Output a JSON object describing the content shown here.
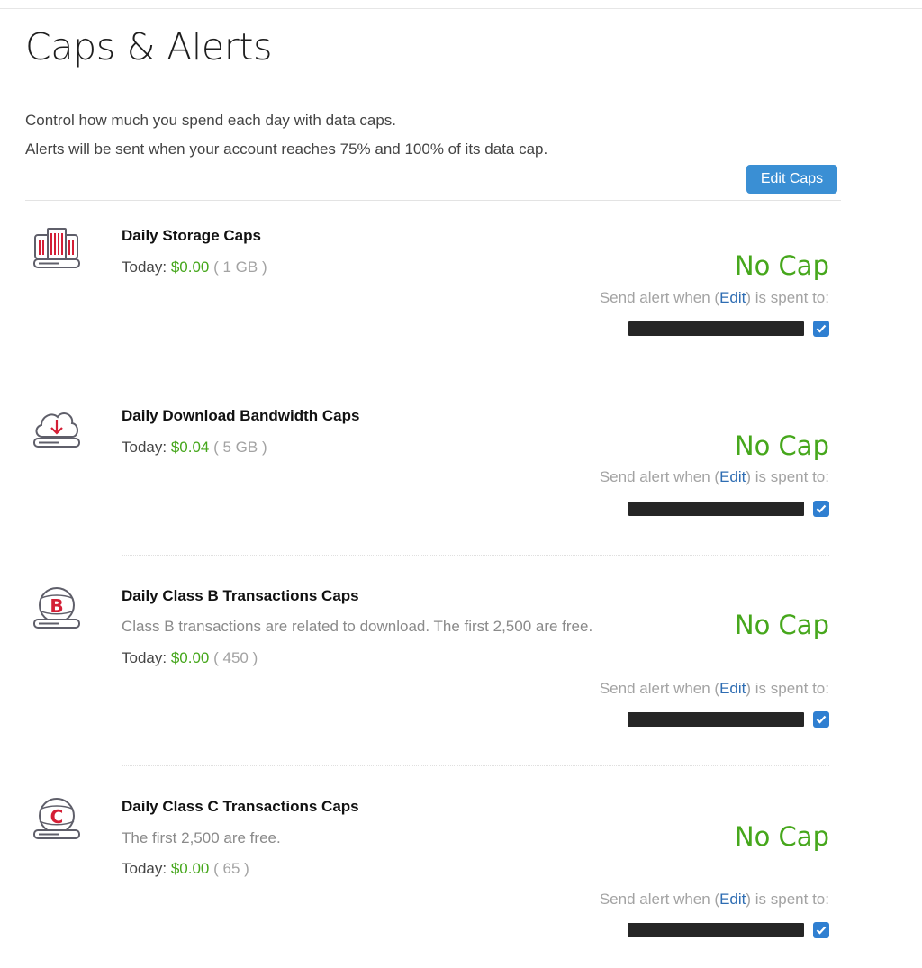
{
  "page": {
    "title": "Caps & Alerts",
    "intro_line1": "Control how much you spend each day with data caps.",
    "intro_line2": "Alerts will be sent when your account reaches 75% and 100% of its data cap.",
    "edit_caps_label": "Edit Caps"
  },
  "colors": {
    "accent_blue": "#3a8fd4",
    "amount_green": "#46a71c",
    "icon_red": "#d41f36",
    "icon_gray": "#5f5f6a",
    "link_blue": "#2e6db3"
  },
  "sections": [
    {
      "title": "Daily Storage Caps",
      "description": "",
      "today_label": "Today:",
      "amount": "$0.00",
      "usage": "( 1 GB )",
      "cap": "No Cap",
      "alert_prefix": "Send alert when (",
      "alert_edit": "Edit",
      "alert_suffix": ") is spent to:",
      "icon": "storage-server-icon",
      "alert_checked": true
    },
    {
      "title": "Daily Download Bandwidth Caps",
      "description": "",
      "today_label": "Today:",
      "amount": "$0.04",
      "usage": "( 5 GB )",
      "cap": "No Cap",
      "alert_prefix": "Send alert when (",
      "alert_edit": "Edit",
      "alert_suffix": ") is spent to:",
      "icon": "cloud-download-icon",
      "alert_checked": true
    },
    {
      "title": "Daily Class B Transactions Caps",
      "description": "Class B transactions are related to download. The first 2,500 are free.",
      "today_label": "Today:",
      "amount": "$0.00",
      "usage": "( 450 )",
      "cap": "No Cap",
      "alert_prefix": "Send alert when (",
      "alert_edit": "Edit",
      "alert_suffix": ") is spent to:",
      "icon": "class-b-globe-icon",
      "icon_letter": "B",
      "alert_checked": true
    },
    {
      "title": "Daily Class C Transactions Caps",
      "description": "The first 2,500 are free.",
      "today_label": "Today:",
      "amount": "$0.00",
      "usage": "( 65 )",
      "cap": "No Cap",
      "alert_prefix": "Send alert when (",
      "alert_edit": "Edit",
      "alert_suffix": ") is spent to:",
      "icon": "class-c-globe-icon",
      "icon_letter": "C",
      "alert_checked": true
    }
  ]
}
